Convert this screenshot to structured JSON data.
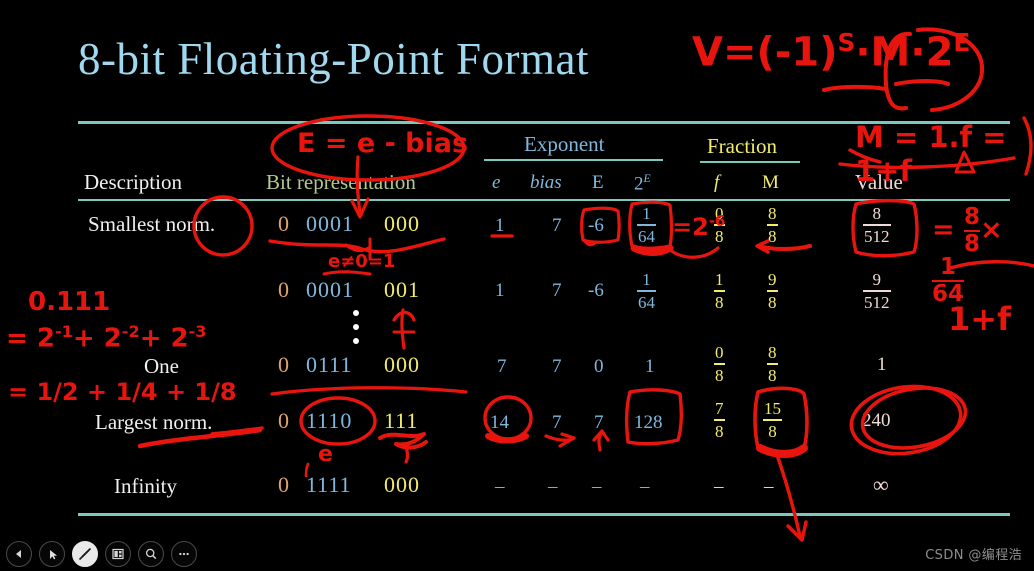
{
  "slide": {
    "title": "8-bit Floating-Point Format",
    "watermark": "CSDN @编程浩"
  },
  "table": {
    "headers": {
      "description": "Description",
      "bit_representation": "Bit representation",
      "exponent_group": "Exponent",
      "fraction_group": "Fraction",
      "value": "Value",
      "e": "e",
      "bias": "bias",
      "E": "E",
      "two_E": "2",
      "two_E_sup": "E",
      "f": "f",
      "M": "M"
    },
    "rows": [
      {
        "description": "Smallest norm.",
        "sign": "0",
        "exp_bits": "0001",
        "frac_bits": "000",
        "e": "1",
        "bias": "7",
        "E": "-6",
        "two_E_num": "1",
        "two_E_den": "64",
        "f_num": "0",
        "f_den": "8",
        "M_num": "8",
        "M_den": "8",
        "value_num": "8",
        "value_den": "512"
      },
      {
        "description": "",
        "sign": "0",
        "exp_bits": "0001",
        "frac_bits": "001",
        "e": "1",
        "bias": "7",
        "E": "-6",
        "two_E_num": "1",
        "two_E_den": "64",
        "f_num": "1",
        "f_den": "8",
        "M_num": "9",
        "M_den": "8",
        "value_num": "9",
        "value_den": "512"
      },
      {
        "description": "One",
        "sign": "0",
        "exp_bits": "0111",
        "frac_bits": "000",
        "e": "7",
        "bias": "7",
        "E": "0",
        "two_E_plain": "1",
        "f_num": "0",
        "f_den": "8",
        "M_num": "8",
        "M_den": "8",
        "value_plain": "1"
      },
      {
        "description": "Largest norm.",
        "sign": "0",
        "exp_bits": "1110",
        "frac_bits": "111",
        "e": "14",
        "bias": "7",
        "E": "7",
        "two_E_plain": "128",
        "f_num": "7",
        "f_den": "8",
        "M_num": "15",
        "M_den": "8",
        "value_plain": "240"
      },
      {
        "description": "Infinity",
        "sign": "0",
        "exp_bits": "1111",
        "frac_bits": "000",
        "e": "–",
        "bias": "–",
        "E": "–",
        "two_E_plain": "–",
        "f_plain": "–",
        "M_plain": "–",
        "value_plain": "∞"
      }
    ],
    "ellipsis_marker": "vertical-ellipsis"
  },
  "annotations": {
    "formula_main": "V = (-1)S · M · 2E",
    "formula_V": "V",
    "formula_eq": "=",
    "formula_paren_open": "(",
    "formula_minus_one": "-1",
    "formula_paren_close": ")",
    "formula_S": "S",
    "formula_dot1": "·",
    "formula_M": "M",
    "formula_dot2": "·",
    "formula_2": "2",
    "formula_E": "E",
    "E_equals_e_minus_bias": "E = e - bias",
    "M_definition": "M = 1.f = 1+f",
    "e_not_zero": "e≠0=1",
    "e_label": "e",
    "two_pow_minus6": "=2",
    "two_pow_minus6_sup": "-6",
    "one_plus_f": "1+f",
    "binary_expansion_1": "0.111",
    "binary_expansion_2_prefix": "=  2",
    "binary_expansion_2_sup1": "-1",
    "binary_expansion_2_mid": "+ 2",
    "binary_expansion_2_sup2": "-2",
    "binary_expansion_2_mid2": "+ 2",
    "binary_expansion_2_sup3": "-3",
    "binary_expansion_3": "= 1/2 + 1/4 + 1/8",
    "value_check_eq": "=",
    "value_check_frac1_n": "8",
    "value_check_frac1_d": "8",
    "value_check_times": "×",
    "value_check_frac2_n": "1",
    "value_check_frac2_d": "64"
  },
  "toolbar": {
    "items": [
      {
        "name": "previous-slide-button",
        "icon": "triangle-left-icon"
      },
      {
        "name": "next-slide-button",
        "icon": "cursor-arrow-icon"
      },
      {
        "name": "pen-tool-button",
        "icon": "pen-slash-icon"
      },
      {
        "name": "slide-overview-button",
        "icon": "grid-layout-icon"
      },
      {
        "name": "zoom-button",
        "icon": "magnifier-icon"
      },
      {
        "name": "more-options-button",
        "icon": "ellipsis-icon"
      }
    ]
  }
}
